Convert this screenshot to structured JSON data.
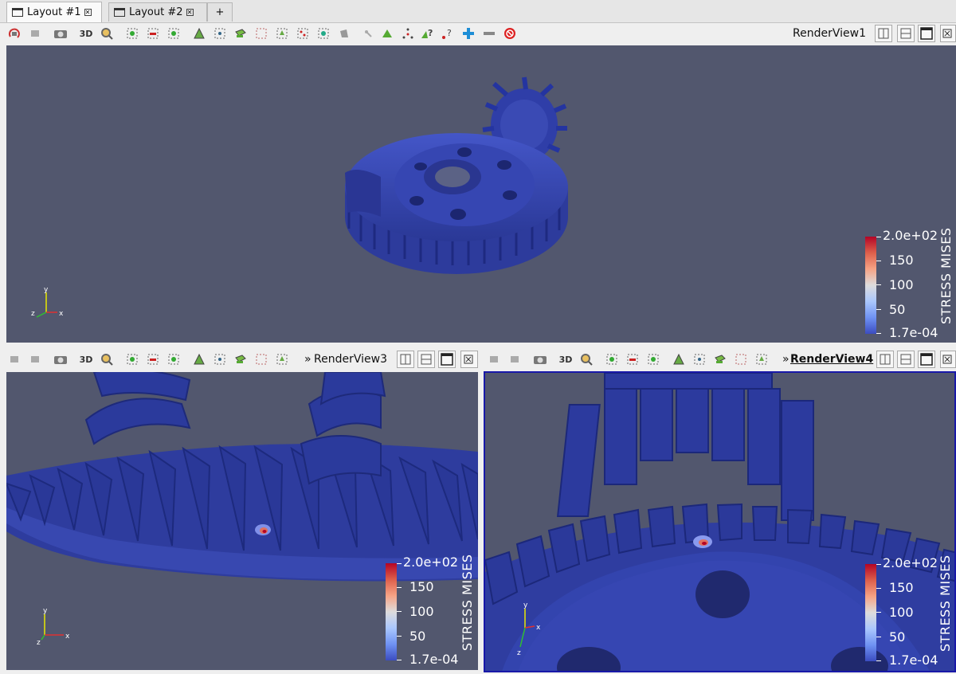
{
  "tabs": [
    {
      "label": "Layout #1",
      "active": true
    },
    {
      "label": "Layout #2",
      "active": false
    },
    {
      "label": "+",
      "active": false
    }
  ],
  "views": {
    "top": {
      "title": "RenderView1",
      "bold": false
    },
    "bottom_left": {
      "title": "RenderView3",
      "bold": false
    },
    "bottom_right": {
      "title": "RenderView4",
      "bold": true
    }
  },
  "toolbar": {
    "mode_3d": "3D",
    "collapse": "»"
  },
  "colorbar": {
    "title": "STRESS MISES",
    "labels": [
      "2.0e+02",
      "150",
      "100",
      "50",
      "1.7e-04"
    ]
  },
  "axes": {
    "x": "x",
    "y": "y",
    "z": "z"
  },
  "colors": {
    "background": "#52576e",
    "gear": "#3a4ab4",
    "active_border": "#1818a8",
    "stress_high": "#b40426",
    "stress_low": "#3b4cc0"
  }
}
